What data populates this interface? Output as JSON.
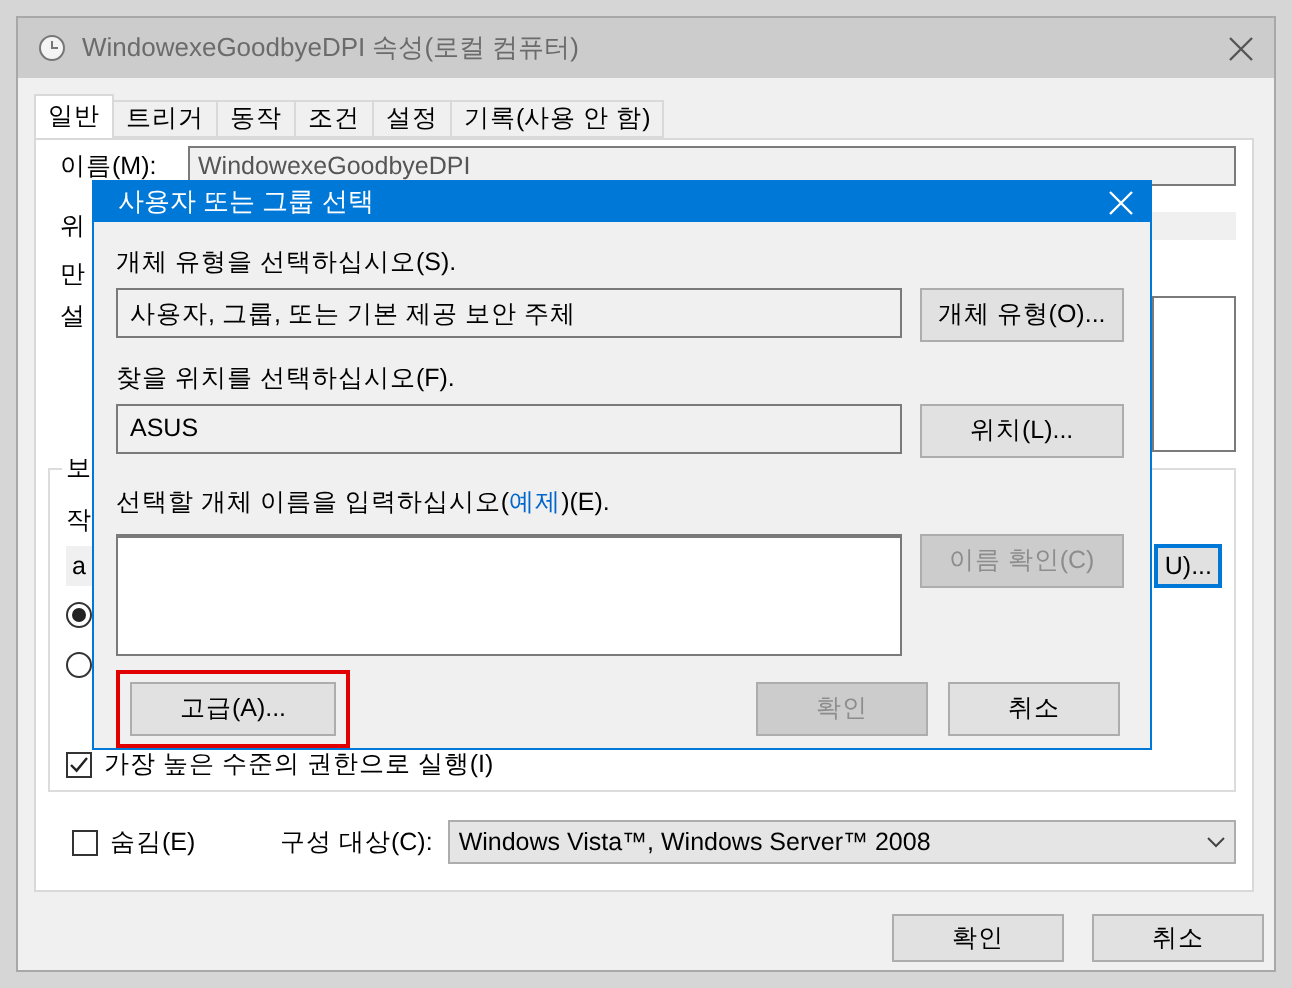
{
  "window": {
    "title": "WindowexeGoodbyeDPI 속성(로컬 컴퓨터)"
  },
  "tabs": [
    {
      "label": "일반",
      "selected": true
    },
    {
      "label": "트리거",
      "selected": false
    },
    {
      "label": "동작",
      "selected": false
    },
    {
      "label": "조건",
      "selected": false
    },
    {
      "label": "설정",
      "selected": false
    },
    {
      "label": "기록(사용 안 함)",
      "selected": false
    }
  ],
  "general": {
    "name_label": "이름(M):",
    "name_value": "WindowexeGoodbyeDPI",
    "fragments": [
      "위",
      "만",
      "설"
    ],
    "security": {
      "legend": "보",
      "fragment_label": "작",
      "fragment_field": "a",
      "button": "U)...",
      "button_focused": true,
      "radios": [
        {
          "selected": true
        },
        {
          "selected": false
        }
      ],
      "run_highest": {
        "label": "가장 높은 수준의 권한으로 실행(I)",
        "checked": true
      }
    }
  },
  "hidden": {
    "label": "숨김(E)",
    "checked": false
  },
  "configure": {
    "label": "구성 대상(C):",
    "value": "Windows Vista™, Windows Server™ 2008"
  },
  "buttons": [
    "확인",
    "취소"
  ],
  "dialog": {
    "title": "사용자 또는 그룹 선택",
    "object_type_label": "개체 유형을 선택하십시오(S).",
    "object_type_value": "사용자, 그룹, 또는 기본 제공 보안 주체",
    "object_type_button": "개체 유형(O)...",
    "location_label": "찾을 위치를 선택하십시오(F).",
    "location_value": "ASUS",
    "location_button": "위치(L)...",
    "names_label_before": "선택할 개체 이름을 입력하십시오(",
    "names_link": "예제",
    "names_label_after": ")(E).",
    "check_names": {
      "label": "이름 확인(C)",
      "disabled": true
    },
    "advanced": {
      "label": "고급(A)...",
      "highlighted": true
    },
    "ok": {
      "label": "확인",
      "disabled": true
    },
    "cancel": {
      "label": "취소",
      "disabled": false
    }
  }
}
